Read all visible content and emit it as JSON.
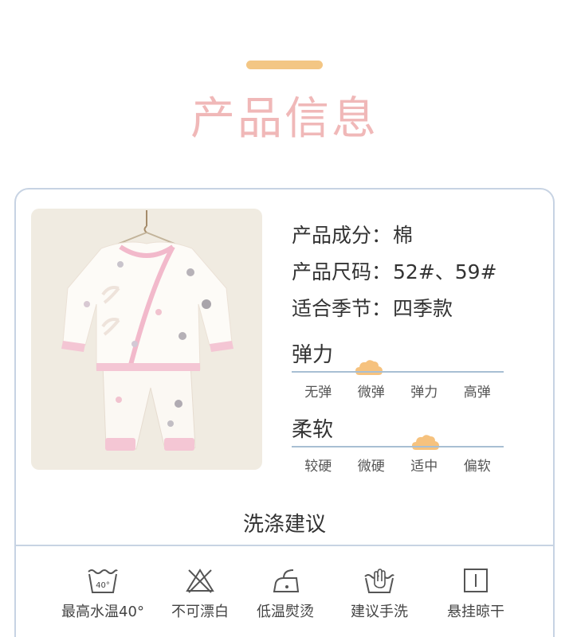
{
  "header": {
    "title": "产品信息"
  },
  "specs": [
    {
      "label": "产品成分：",
      "value": "棉"
    },
    {
      "label": "产品尺码：",
      "value": "52#、59#"
    },
    {
      "label": "适合季节：",
      "value": "四季款"
    }
  ],
  "elasticity": {
    "title": "弹力",
    "options": [
      "无弹",
      "微弹",
      "弹力",
      "高弹"
    ],
    "selected": "微弹"
  },
  "softness": {
    "title": "柔软",
    "options": [
      "较硬",
      "微硬",
      "适中",
      "偏软"
    ],
    "selected": "适中"
  },
  "washing": {
    "title": "洗涤建议",
    "items": [
      {
        "icon": "wash-40-icon",
        "label": "最高水温40°",
        "tub_text": "40°"
      },
      {
        "icon": "no-bleach-icon",
        "label": "不可漂白"
      },
      {
        "icon": "low-iron-icon",
        "label": "低温熨烫"
      },
      {
        "icon": "hand-wash-icon",
        "label": "建议手洗"
      },
      {
        "icon": "hang-dry-icon",
        "label": "悬挂晾干"
      }
    ]
  },
  "colors": {
    "accent_bar": "#f3c684",
    "title_pink": "#f0b8b8",
    "card_border": "#c7d3e3",
    "marker": "#f6c27e"
  }
}
